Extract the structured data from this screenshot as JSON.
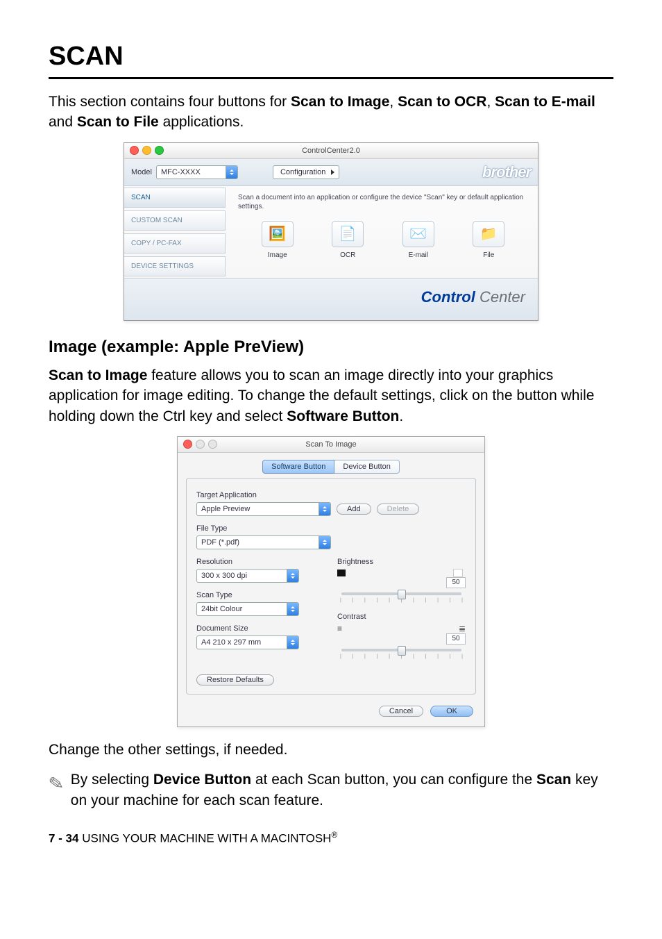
{
  "page": {
    "title": "SCAN",
    "intro_parts": {
      "a": "This section contains four buttons for ",
      "b": "Scan to Image",
      "c": ", ",
      "d": "Scan to OCR",
      "e": ", ",
      "f": "Scan to E-mail",
      "g": " and ",
      "h": "Scan to File",
      "i": " applications."
    },
    "subhead": "Image (example: Apple PreView)",
    "body_parts": {
      "a": "Scan to Image",
      "b": " feature allows you to scan an image directly into your graphics application for image editing. To change the default settings, click on the button while holding down the Ctrl key and select ",
      "c": "Software Button",
      "d": "."
    },
    "after_dialog": "Change the other settings, if needed.",
    "note": {
      "a": "By selecting ",
      "b": "Device Button",
      "c": " at each Scan button, you can configure the ",
      "d": "Scan",
      "e": " key on your machine for each scan feature."
    },
    "footer": {
      "pageref": "7 - 34",
      "spacer": "   ",
      "text": "USING YOUR MACHINE WITH A MACINTOSH",
      "reg": "®"
    }
  },
  "cc": {
    "title": "ControlCenter2.0",
    "model_label": "Model",
    "model_value": "MFC-XXXX",
    "config_btn": "Configuration",
    "brand": "brother",
    "sidebar": [
      "SCAN",
      "CUSTOM SCAN",
      "COPY / PC-FAX",
      "DEVICE SETTINGS"
    ],
    "desc": "Scan a document into an application or configure the device \"Scan\" key or default application settings.",
    "icons": [
      {
        "glyph": "🖼️",
        "label": "Image"
      },
      {
        "glyph": "📄",
        "label": "OCR"
      },
      {
        "glyph": "✉️",
        "label": "E-mail"
      },
      {
        "glyph": "📁",
        "label": "File"
      }
    ],
    "footer_control": "Control",
    "footer_center": " Center"
  },
  "sti": {
    "title": "Scan To Image",
    "tabs": [
      "Software Button",
      "Device Button"
    ],
    "target_app_label": "Target Application",
    "target_app_value": "Apple Preview",
    "add_btn": "Add",
    "delete_btn": "Delete",
    "file_type_label": "File Type",
    "file_type_value": "PDF (*.pdf)",
    "resolution_label": "Resolution",
    "resolution_value": "300 x 300 dpi",
    "scan_type_label": "Scan Type",
    "scan_type_value": "24bit Colour",
    "doc_size_label": "Document Size",
    "doc_size_value": "A4 210 x 297 mm",
    "brightness_label": "Brightness",
    "brightness_value": "50",
    "contrast_label": "Contrast",
    "contrast_value": "50",
    "restore_btn": "Restore Defaults",
    "cancel_btn": "Cancel",
    "ok_btn": "OK"
  }
}
